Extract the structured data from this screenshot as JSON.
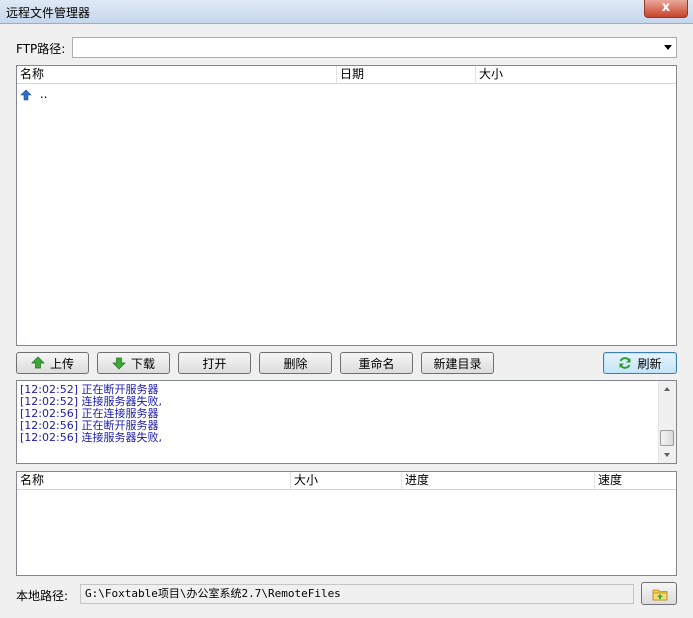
{
  "window": {
    "title": "远程文件管理器",
    "close_label": "x"
  },
  "ftp": {
    "label": "FTP路径:",
    "value": ""
  },
  "remote_list": {
    "columns": [
      "名称",
      "日期",
      "大小"
    ],
    "rows": [
      {
        "name": "..",
        "date": "",
        "size": ""
      }
    ]
  },
  "toolbar": {
    "upload": "上传",
    "download": "下载",
    "open": "打开",
    "delete": "删除",
    "rename": "重命名",
    "new_dir": "新建目录",
    "refresh": "刷新"
  },
  "log": [
    {
      "time": "[12:02:52]",
      "msg": "正在断开服务器"
    },
    {
      "time": "[12:02:52]",
      "msg": "连接服务器失败,"
    },
    {
      "time": "[12:02:56]",
      "msg": "正在连接服务器"
    },
    {
      "time": "[12:02:56]",
      "msg": "正在断开服务器"
    },
    {
      "time": "[12:02:56]",
      "msg": "连接服务器失败,"
    }
  ],
  "transfer_list": {
    "columns": [
      "名称",
      "大小",
      "进度",
      "速度"
    ]
  },
  "local": {
    "label": "本地路径:",
    "path": "G:\\Foxtable项目\\办公室系统2.7\\RemoteFiles"
  },
  "colors": {
    "log_text": "#1b1bb3",
    "titlebar": "#c6d7ec"
  }
}
